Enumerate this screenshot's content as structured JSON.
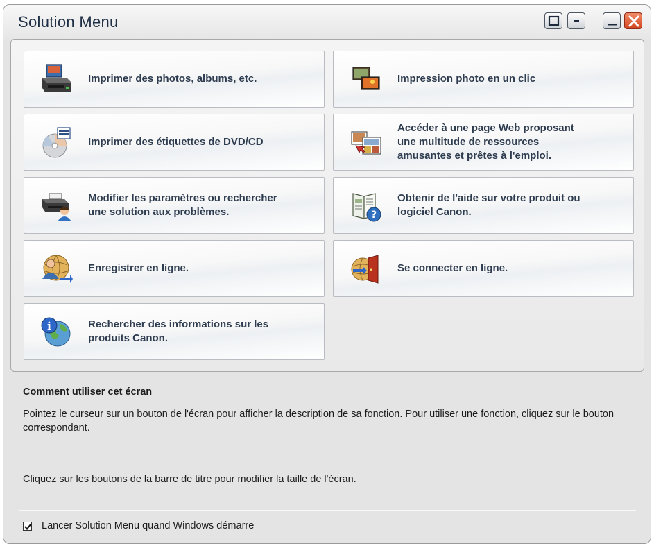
{
  "window": {
    "title": "Solution Menu",
    "title_buttons": [
      "large-view",
      "small-view",
      "minimize",
      "close"
    ]
  },
  "menu": {
    "items": [
      {
        "label": "Imprimer des photos, albums, etc.",
        "icon": "printer-photo-icon"
      },
      {
        "label": "Impression photo en un clic",
        "icon": "photos-icon"
      },
      {
        "label": "Imprimer des étiquettes de DVD/CD",
        "icon": "disc-label-icon"
      },
      {
        "label": "Accéder à une page Web proposant\nune multitude de ressources\namusantes et prêtes à l'emploi.",
        "icon": "web-photos-icon"
      },
      {
        "label": "Modifier les paramètres ou rechercher\nune solution aux problèmes.",
        "icon": "printer-user-icon"
      },
      {
        "label": "Obtenir de l'aide sur votre produit ou\nlogiciel Canon.",
        "icon": "manual-help-icon"
      },
      {
        "label": "Enregistrer en ligne.",
        "icon": "user-globe-icon"
      },
      {
        "label": "Se connecter en ligne.",
        "icon": "globe-door-icon"
      },
      {
        "label": "Rechercher des informations sur les\nproduits Canon.",
        "icon": "info-globe-icon"
      }
    ]
  },
  "help": {
    "title": "Comment utiliser cet écran",
    "text1": "Pointez le curseur sur un bouton de l'écran pour afficher la description de sa fonction. Pour utiliser une fonction, cliquez sur le bouton correspondant.",
    "text2": "Cliquez sur les boutons de la barre de titre pour modifier la taille de l'écran."
  },
  "startup": {
    "label": "Lancer Solution Menu quand Windows démarre",
    "checked": true
  }
}
